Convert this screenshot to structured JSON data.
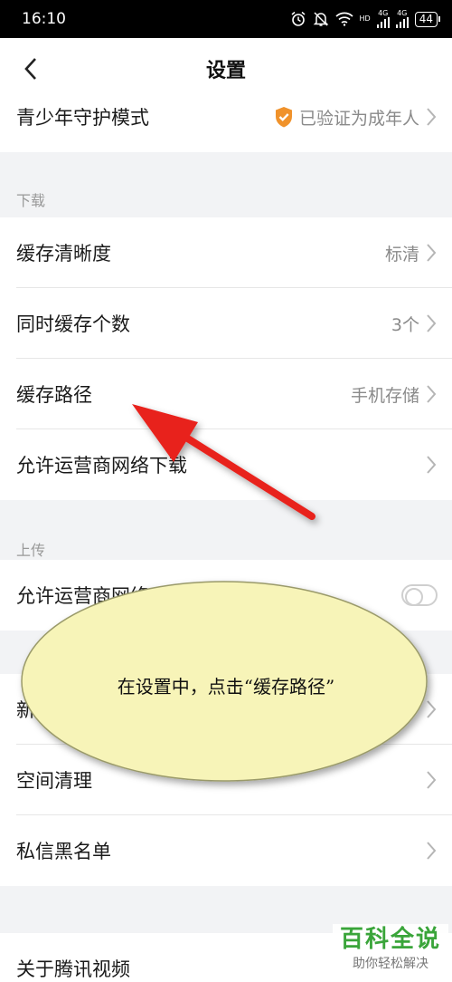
{
  "status_bar": {
    "time": "16:10",
    "network_hd": "HD",
    "network_4g_a": "4G",
    "network_4g_b": "4G",
    "battery": "44",
    "icons": [
      "alarm-icon",
      "bell-off-icon",
      "wifi-icon",
      "signal-icon",
      "signal-icon",
      "battery-icon"
    ]
  },
  "nav": {
    "title": "设置",
    "back_icon": "chevron-left-icon"
  },
  "rows": {
    "teen_mode": {
      "label": "青少年守护模式",
      "value": "已验证为成年人",
      "icon": "shield-check-icon"
    },
    "cache_quality": {
      "label": "缓存清晰度",
      "value": "标清"
    },
    "concurrent_cache": {
      "label": "同时缓存个数",
      "value": "3个"
    },
    "cache_path": {
      "label": "缓存路径",
      "value": "手机存储"
    },
    "allow_carrier_download": {
      "label": "允许运营商网络下载"
    },
    "allow_carrier_upload": {
      "label": "允许运营商网络"
    },
    "hidden_row": {
      "label": "新"
    },
    "space_cleanup": {
      "label": "空间清理"
    },
    "blocklist": {
      "label": "私信黑名单"
    },
    "about": {
      "label": "关于腾讯视频"
    }
  },
  "sections": {
    "download": "下载",
    "upload": "上传"
  },
  "annotation": {
    "text": "在设置中，点击“缓存路径”",
    "arrow_color": "#e8201c",
    "bubble_color": "#f7f4b8"
  },
  "watermark": {
    "main": "百科全说",
    "sub": "助你轻松解决"
  }
}
